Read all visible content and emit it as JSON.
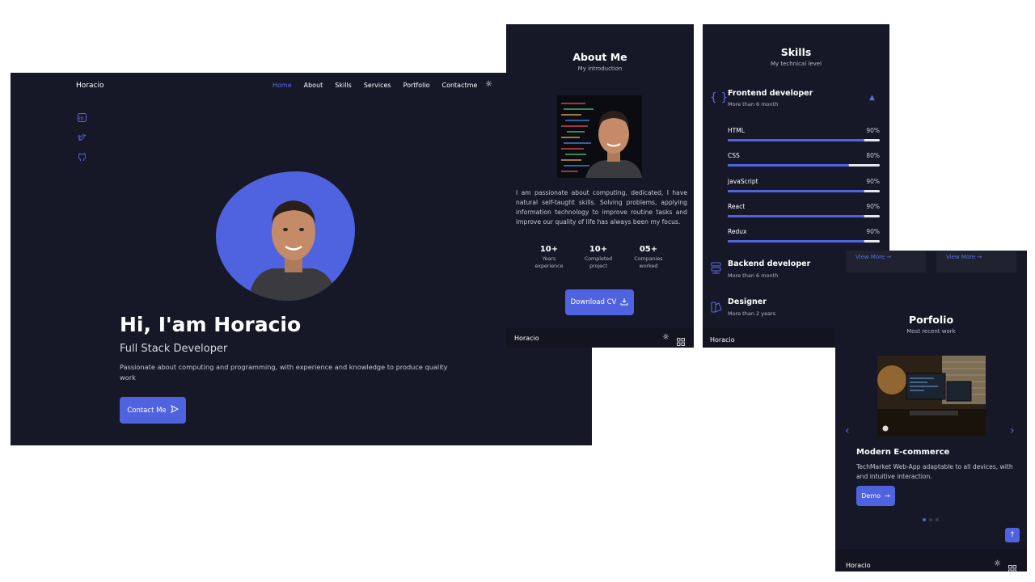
{
  "hero": {
    "logo": "Horacio",
    "nav": [
      "Home",
      "About",
      "Skills",
      "Services",
      "Portfolio",
      "Contactme"
    ],
    "social_icons": [
      "linkedin-icon",
      "twitter-icon",
      "github-icon"
    ],
    "title": "Hi, I'am Horacio",
    "subtitle": "Full Stack Developer",
    "description": "Passionate about computing and programming, with experience and knowledge to produce quality work",
    "button": "Contact Me",
    "accent": "#4f63e0"
  },
  "about": {
    "title": "About Me",
    "subtitle": "My introduction",
    "text": "I am passionate about computing, dedicated, I have natural self-taught skills. Solving problems, applying information technology to improve routine tasks and improve our quality of life has always been my focus.",
    "stats": [
      {
        "value": "10+",
        "label1": "Years",
        "label2": "experience"
      },
      {
        "value": "10+",
        "label1": "Completed",
        "label2": "project"
      },
      {
        "value": "05+",
        "label1": "Companies",
        "label2": "worked"
      }
    ],
    "button": "Download CV",
    "footer_logo": "Horacio"
  },
  "skills": {
    "title": "Skills",
    "subtitle": "My technical level",
    "frontend": {
      "title": "Frontend developer",
      "sub": "More than 6 month"
    },
    "items": [
      {
        "name": "HTML",
        "pct": "90%",
        "value": 90
      },
      {
        "name": "CSS",
        "pct": "80%",
        "value": 80
      },
      {
        "name": "JavaScript",
        "pct": "90%",
        "value": 90
      },
      {
        "name": "React",
        "pct": "90%",
        "value": 90
      },
      {
        "name": "Redux",
        "pct": "90%",
        "value": 90
      }
    ],
    "backend": {
      "title": "Backend developer",
      "sub": "More than 6 month"
    },
    "designer": {
      "title": "Designer",
      "sub": "More than 2 years"
    },
    "footer_logo": "Horacio"
  },
  "portfolio": {
    "view_more": "View More",
    "title": "Porfolio",
    "subtitle": "Most recent work",
    "project_title": "Modern E-commerce",
    "project_desc": "TechMarket Web-App adaptable to all devices, with and intuitive interaction.",
    "button": "Demo",
    "footer_logo": "Horacio"
  }
}
